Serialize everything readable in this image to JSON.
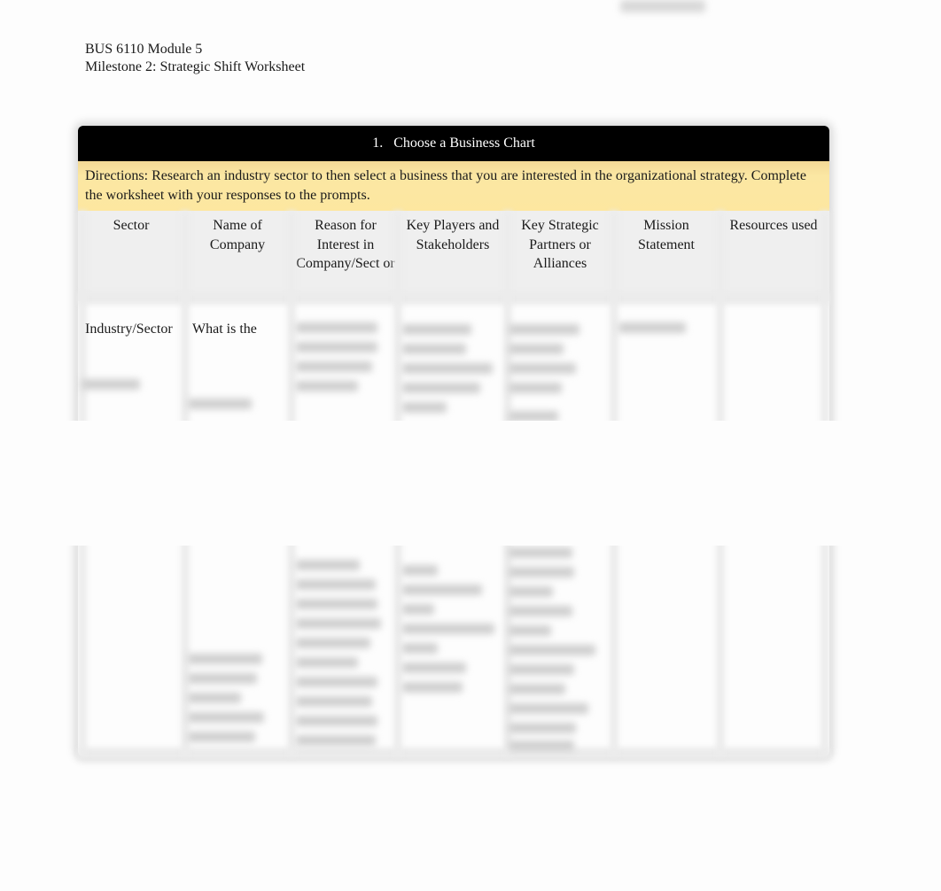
{
  "header_preview_text": "(blurred)",
  "document": {
    "course": "BUS 6110 Module 5",
    "subtitle": "Milestone 2: Strategic Shift Worksheet"
  },
  "worksheet": {
    "section_number": "1.",
    "section_title": "Choose a Business Chart",
    "directions": "Directions:  Research an industry sector to then select a business that you are interested in the organizational strategy. Complete the worksheet with your responses to the prompts.",
    "columns": [
      {
        "label": "Sector"
      },
      {
        "label": "Name of Company"
      },
      {
        "label": "Reason for Interest in Company/Sect or"
      },
      {
        "label": "Key Players and Stakeholders"
      },
      {
        "label": "Key Strategic Partners or Alliances"
      },
      {
        "label": "Mission Statement"
      },
      {
        "label": "Resources used"
      }
    ],
    "row": {
      "sector": "Industry/Sector",
      "company_prompt": "What is the"
    }
  },
  "colors": {
    "title_bar": "#000000",
    "directions_bg": "#fde7a0",
    "header_bg": "#efefef"
  }
}
